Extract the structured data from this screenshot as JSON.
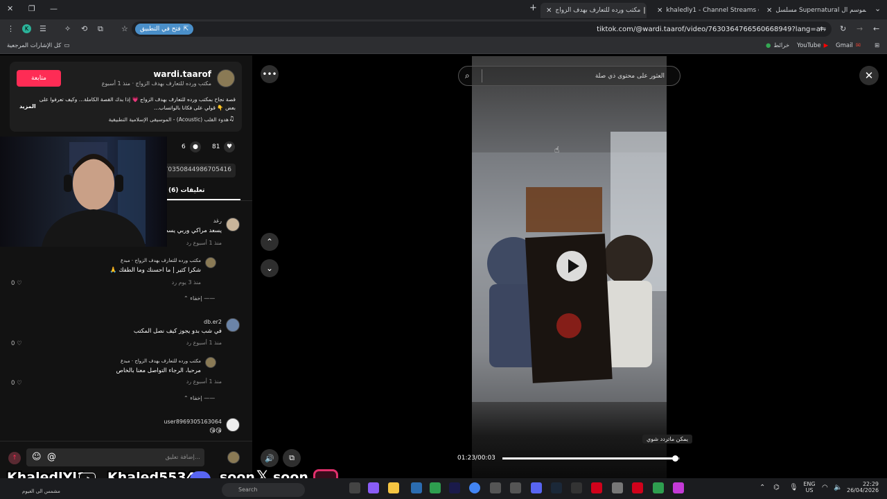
{
  "browser": {
    "tabs": [
      {
        "title": "مسلسل Supernatural الموسم ال",
        "active": false
      },
      {
        "title": "khaledly1 - Channel Streams o",
        "active": false
      },
      {
        "title": "مكتب ورده للتعارف بهدف الزواج",
        "active": true
      }
    ],
    "new_tab_label": "+",
    "url": "tiktok.com/@wardi.taarof/video/7630364766560668949?lang=ar",
    "open_in_app": "فتح في التطبيق",
    "profile_initial": "K"
  },
  "bookmarks": {
    "items": [
      "Gmail",
      "YouTube",
      "خرائط"
    ],
    "all_bookmarks": "كل الإشارات المرجعية"
  },
  "post": {
    "username": "wardi.taarof",
    "subtitle": "مكتب ورده للتعارف بهدف الزواج · منذ 1 أسبوع",
    "follow_label": "متابعة",
    "description": "قصة نجاح بمكتب ورده للتعارف بهدف الزواج 💗 إذا بدك القصة الكاملة… وكيف تعرفوا على بعض 👇 قولي على فكانا بالواتساب…",
    "more_label": "المزيد",
    "music": "هدوء القلب (Acoustic) - الموسيقى الإسلامية التطبيقية",
    "likes": "81",
    "comments_count": "6",
    "link_fragment": "7035084498670541​6",
    "comments_tab": "تعليقات (6)"
  },
  "comments": [
    {
      "name": "رغد",
      "text": "يسعد مراكي وربي يسطلة",
      "meta": "منذ 1 أسبوع   رد"
    },
    {
      "name": "مكتب ورده للتعارف بهدف الزواج · مبدع",
      "text": "شكرا كثير | ما احسنك وما الطفك 🙏",
      "meta": "منذ 3 يوم   رد",
      "likes": "0",
      "reply": true
    },
    {
      "name": "db.er2",
      "text": "في شب بدو يجوز كيف نصل المكتب",
      "meta": "منذ 1 أسبوع   رد",
      "likes": "0"
    },
    {
      "name": "مكتب ورده للتعارف بهدف الزواج · مبدع",
      "text": "مرحبا، الرجاء التواصل معنا بالخاص",
      "meta": "منذ 1 أسبوع   رد",
      "likes": "0",
      "reply": true
    },
    {
      "name": "user8969305163064",
      "text": "😘😘",
      "meta": ""
    }
  ],
  "hide_label": "إخفاء",
  "comment_placeholder": "إضافة تعليق...",
  "video": {
    "search_placeholder": "العثور على محتوى ذي صلة",
    "time": "01:23/00:03",
    "tooltip": "يمكن ماتردد شوي",
    "progress": 0.98
  },
  "overlay": {
    "kick": "KhaledlYl1",
    "discord": "Khaled5534",
    "x_label": "soon",
    "ig_label": "soon"
  },
  "taskbar": {
    "search_label": "Search",
    "lang": "ENG",
    "region": "US",
    "time": "22:29",
    "date": "26/04/2026",
    "weather": "مشمس الى الغيوم"
  },
  "colors": {
    "follow": "#fe2c55",
    "accent": "#4a8fc9"
  }
}
